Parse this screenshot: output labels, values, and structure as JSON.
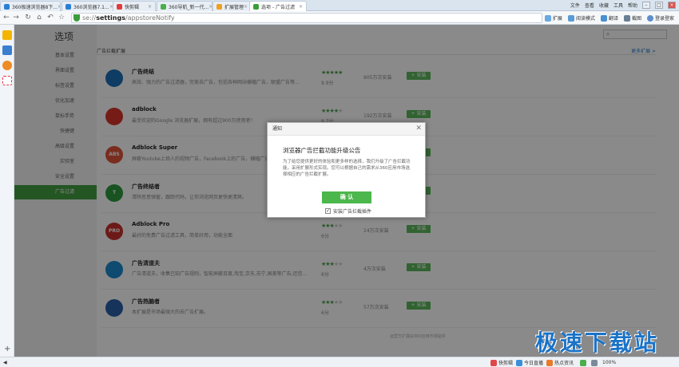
{
  "tabs": [
    {
      "label": "360极速浏览器8下...",
      "color": "#2a7fd4"
    },
    {
      "label": "360浏览器7.1...",
      "color": "#2a7fd4"
    },
    {
      "label": "快剪辑",
      "color": "#e23b3b"
    },
    {
      "label": "360导航_新一代...",
      "color": "#4cae4c"
    },
    {
      "label": "扩展管理",
      "color": "#f0a020"
    },
    {
      "label": "选项 - 广告过滤",
      "color": "#3a9e3a",
      "active": true
    }
  ],
  "window_menu": {
    "file": "文件",
    "view": "查看",
    "bookmarks": "收藏",
    "tools": "工具",
    "help": "帮助"
  },
  "address": {
    "prefix": "se://",
    "bold": "settings",
    "suffix": "/appstoreNotify"
  },
  "toolbar": {
    "extensions": "扩展",
    "reader": "阅读模式",
    "translate": "翻译",
    "screenshot": "截图",
    "login": "登录登家"
  },
  "page": {
    "title": "选项",
    "nav": [
      {
        "label": "基本设置"
      },
      {
        "label": "界面设置"
      },
      {
        "label": "标签设置"
      },
      {
        "label": "优化加速"
      },
      {
        "label": "鼠标手势"
      },
      {
        "label": "快捷键"
      },
      {
        "label": "高级设置"
      },
      {
        "label": "实验室"
      },
      {
        "label": "安全设置"
      },
      {
        "label": "广告过滤",
        "active": true
      }
    ],
    "section_title": "广告拦截扩展",
    "more_link": "更多扩展 >",
    "footer": "运营方扩展由360应用市场提供"
  },
  "extensions": [
    {
      "name": "广告终结",
      "desc": "高效、强力的广告过滤器，完美去广告，包括各种网站横幅广告，联盟广告等...",
      "stars": 5,
      "score": "9.9分",
      "installs": "905万次安装",
      "install_label": "+ 安装",
      "icon_color": "#1a6fb5",
      "icon_text": ""
    },
    {
      "name": "adblock",
      "desc": "最受欢迎的Google 浏览器扩展，拥有超过900万使用者！",
      "stars": 4,
      "score": "9.7分",
      "installs": "192万次安装",
      "install_label": "+ 安装",
      "icon_color": "#d9342b",
      "icon_text": ""
    },
    {
      "name": "Adblock Super",
      "desc": "屏蔽Youtube上烦人的视频广告，Facebook上的广告，横幅广告",
      "stars": 4,
      "score": "9.0分",
      "installs": "",
      "install_label": "+ 安装",
      "icon_color": "#e0543a",
      "icon_text": "ABS"
    },
    {
      "name": "广告终结者",
      "desc": "清除恶意弹窗，跟踪代码，让你浏览网页更快更清爽。",
      "stars": 4,
      "score": "",
      "installs": "",
      "install_label": "+ 安装",
      "icon_color": "#2e9a3e",
      "icon_text": "T"
    },
    {
      "name": "Adblock Pro",
      "desc": "最好的免费广告过滤工具，简单好用，功能全面",
      "stars": 3,
      "score": "6分",
      "installs": "14万次安装",
      "install_label": "+ 安装",
      "icon_color": "#c8302d",
      "icon_text": "PRO"
    },
    {
      "name": "广告清道夫",
      "desc": "广告清道夫，收集已知广告规则，智能屏蔽百度,淘宝,京东,苏宁,国美等广告,还您...",
      "stars": 3,
      "score": "6分",
      "installs": "4万次安装",
      "install_label": "+ 安装",
      "icon_color": "#1c8ad0",
      "icon_text": ""
    },
    {
      "name": "广告热脑者",
      "desc": "本扩展是市场最强大的去广告扩展。",
      "stars": 3,
      "score": "6分",
      "installs": "57万次安装",
      "install_label": "+ 安装",
      "icon_color": "#2a5ea8",
      "icon_text": ""
    }
  ],
  "dialog": {
    "header": "通知",
    "title": "浏览器广告拦截功能升级公告",
    "body": "为了给您提供更好的体验和更多样的选择，我们升级了广告拦截功能，采用扩展形式实现。您可以根据自己的需求从360应用市场选择相应的广告拦截扩展。",
    "ok": "确 认",
    "checkbox": "安装广告拦截插件"
  },
  "status": {
    "video": "快剪辑",
    "live": "今日直播",
    "news": "热点资讯",
    "zoom": "100%"
  },
  "watermark": "极速下载站",
  "colors": {
    "accent": "#43a043",
    "link": "#2a7fd4"
  }
}
